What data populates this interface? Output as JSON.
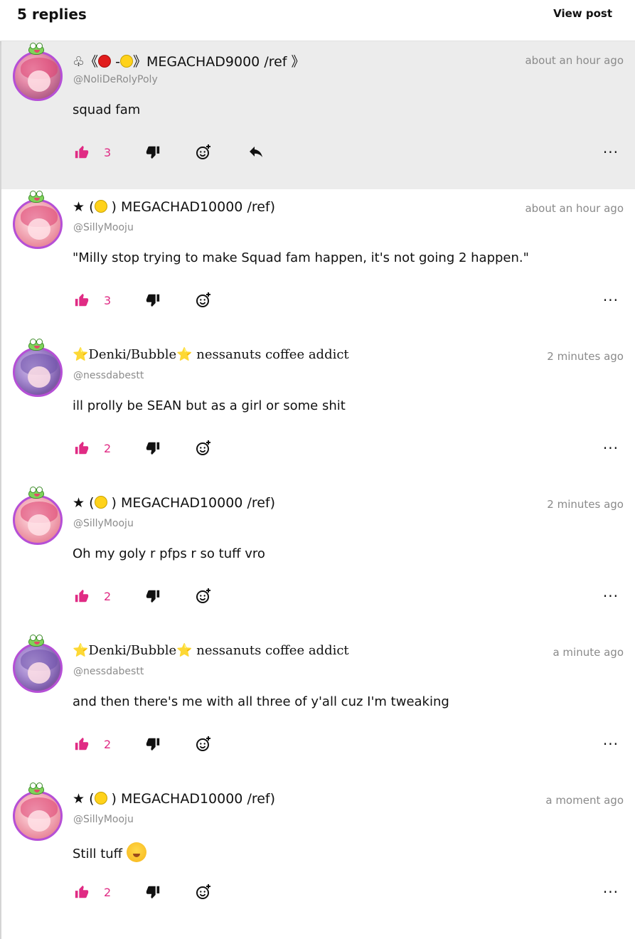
{
  "header": {
    "title": "5 replies",
    "view_post": "View post"
  },
  "colors": {
    "accent": "#e02b84",
    "highlight_bg": "#ececec",
    "avatar_ring": "#b54fd6"
  },
  "comments": [
    {
      "name_prefix": "♧《",
      "name_mid": " -",
      "name_text": "》MEGACHAD9000 /ref 》",
      "handle": "@NoliDeRolyPoly",
      "time": "about an hour ago",
      "body": "squad fam",
      "likes": "3",
      "icons": [
        "thumbs-up-icon",
        "thumbs-down-icon",
        "add-reaction-icon",
        "reply-icon",
        "more-icon"
      ]
    },
    {
      "name_prefix": "★ (",
      "name_text": " ) MEGACHAD10000 /ref)",
      "handle": "@SillyMooju",
      "time": "about an hour ago",
      "body": "\"Milly stop trying to make Squad fam happen, it's not going 2 happen.\"",
      "likes": "3"
    },
    {
      "name_star1": "⭐",
      "name_text": "Denki/Bubble",
      "name_star2": "⭐",
      "name_tail": " nessanuts coffee addict",
      "handle": "@nessdabestt",
      "time": "2 minutes ago",
      "body": "ill prolly be SEAN but as a girl or some shit",
      "likes": "2"
    },
    {
      "name_prefix": "★ (",
      "name_text": " ) MEGACHAD10000 /ref)",
      "handle": "@SillyMooju",
      "time": "2 minutes ago",
      "body": "Oh my goly r pfps r so tuff vro",
      "likes": "2"
    },
    {
      "name_star1": "⭐",
      "name_text": "Denki/Bubble",
      "name_star2": "⭐",
      "name_tail": " nessanuts coffee addict",
      "handle": "@nessdabestt",
      "time": "a minute ago",
      "body": "and then there's me with all three of y'all cuz I'm tweaking",
      "likes": "2"
    },
    {
      "name_prefix": "★ (",
      "name_text": " ) MEGACHAD10000 /ref)",
      "handle": "@SillyMooju",
      "time": "a moment ago",
      "body": "Still tuff",
      "likes": "2"
    }
  ],
  "more_label": "···"
}
